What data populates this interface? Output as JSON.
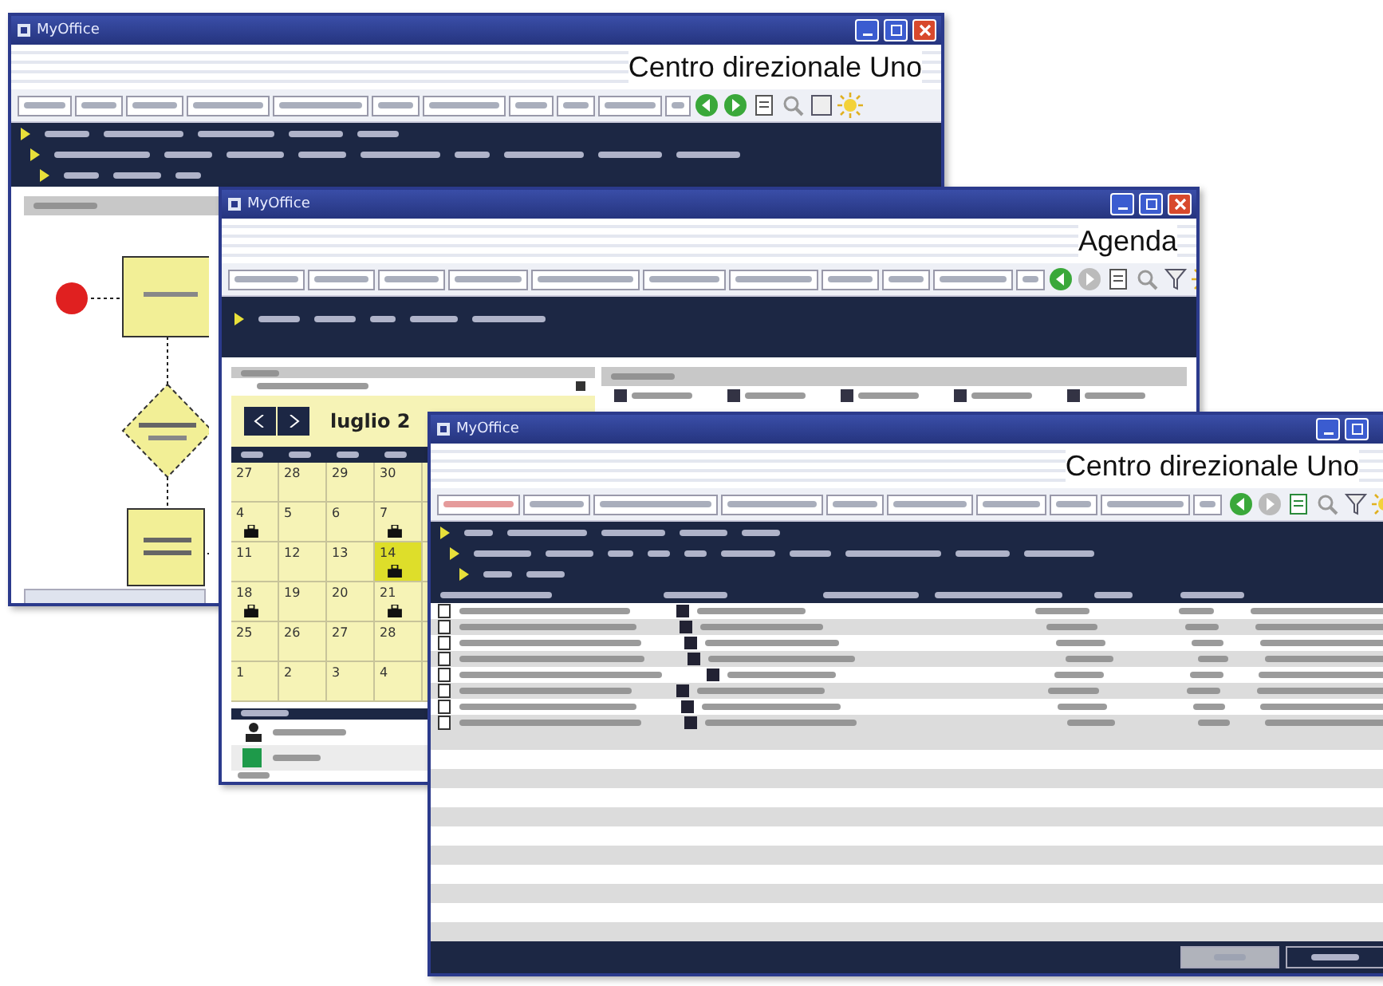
{
  "windows": [
    {
      "title": "MyOffice",
      "heading": "Centro direzionale Uno"
    },
    {
      "title": "MyOffice",
      "heading": "Agenda"
    },
    {
      "title": "MyOffice",
      "heading": "Centro direzionale Uno"
    }
  ],
  "calendar": {
    "month": "luglio 2",
    "days": [
      {
        "day": "27",
        "selected": false
      },
      {
        "day": "28",
        "selected": false
      },
      {
        "day": "29",
        "selected": false
      },
      {
        "day": "30",
        "selected": false
      },
      {
        "day": "4",
        "selected": false
      },
      {
        "day": "5",
        "selected": false
      },
      {
        "day": "6",
        "selected": false
      },
      {
        "day": "7",
        "selected": false
      },
      {
        "day": "11",
        "selected": false
      },
      {
        "day": "12",
        "selected": false
      },
      {
        "day": "13",
        "selected": false
      },
      {
        "day": "14",
        "selected": true
      },
      {
        "day": "18",
        "selected": false
      },
      {
        "day": "19",
        "selected": false
      },
      {
        "day": "20",
        "selected": false
      },
      {
        "day": "21",
        "selected": false
      },
      {
        "day": "25",
        "selected": false
      },
      {
        "day": "26",
        "selected": false
      },
      {
        "day": "27",
        "selected": false
      },
      {
        "day": "28",
        "selected": false
      },
      {
        "day": "1",
        "selected": false
      },
      {
        "day": "2",
        "selected": false
      },
      {
        "day": "3",
        "selected": false
      },
      {
        "day": "4",
        "selected": false
      }
    ]
  }
}
